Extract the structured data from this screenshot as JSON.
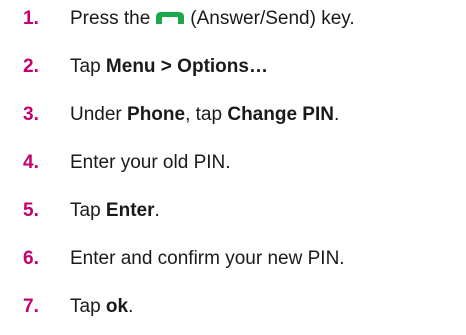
{
  "colors": {
    "step_number": "#c2006f",
    "key_icon": "#1fa84a",
    "text": "#1a1a1a"
  },
  "steps": [
    {
      "number": "1.",
      "before": "Press the",
      "icon": "answer-send-key-icon",
      "after": "(Answer/Send) key."
    },
    {
      "number": "2.",
      "before": "Tap",
      "bold": "Menu > Options…",
      "after": ""
    },
    {
      "number": "3.",
      "before": "Under",
      "bold": "Phone",
      "middle": ", tap",
      "bold2": "Change PIN",
      "after": "."
    },
    {
      "number": "4.",
      "text": "Enter your old PIN."
    },
    {
      "number": "5.",
      "before": "Tap",
      "bold": "Enter",
      "after": "."
    },
    {
      "number": "6.",
      "text": "Enter and confirm your new PIN."
    },
    {
      "number": "7.",
      "before": "Tap",
      "bold": "ok",
      "after": "."
    }
  ]
}
